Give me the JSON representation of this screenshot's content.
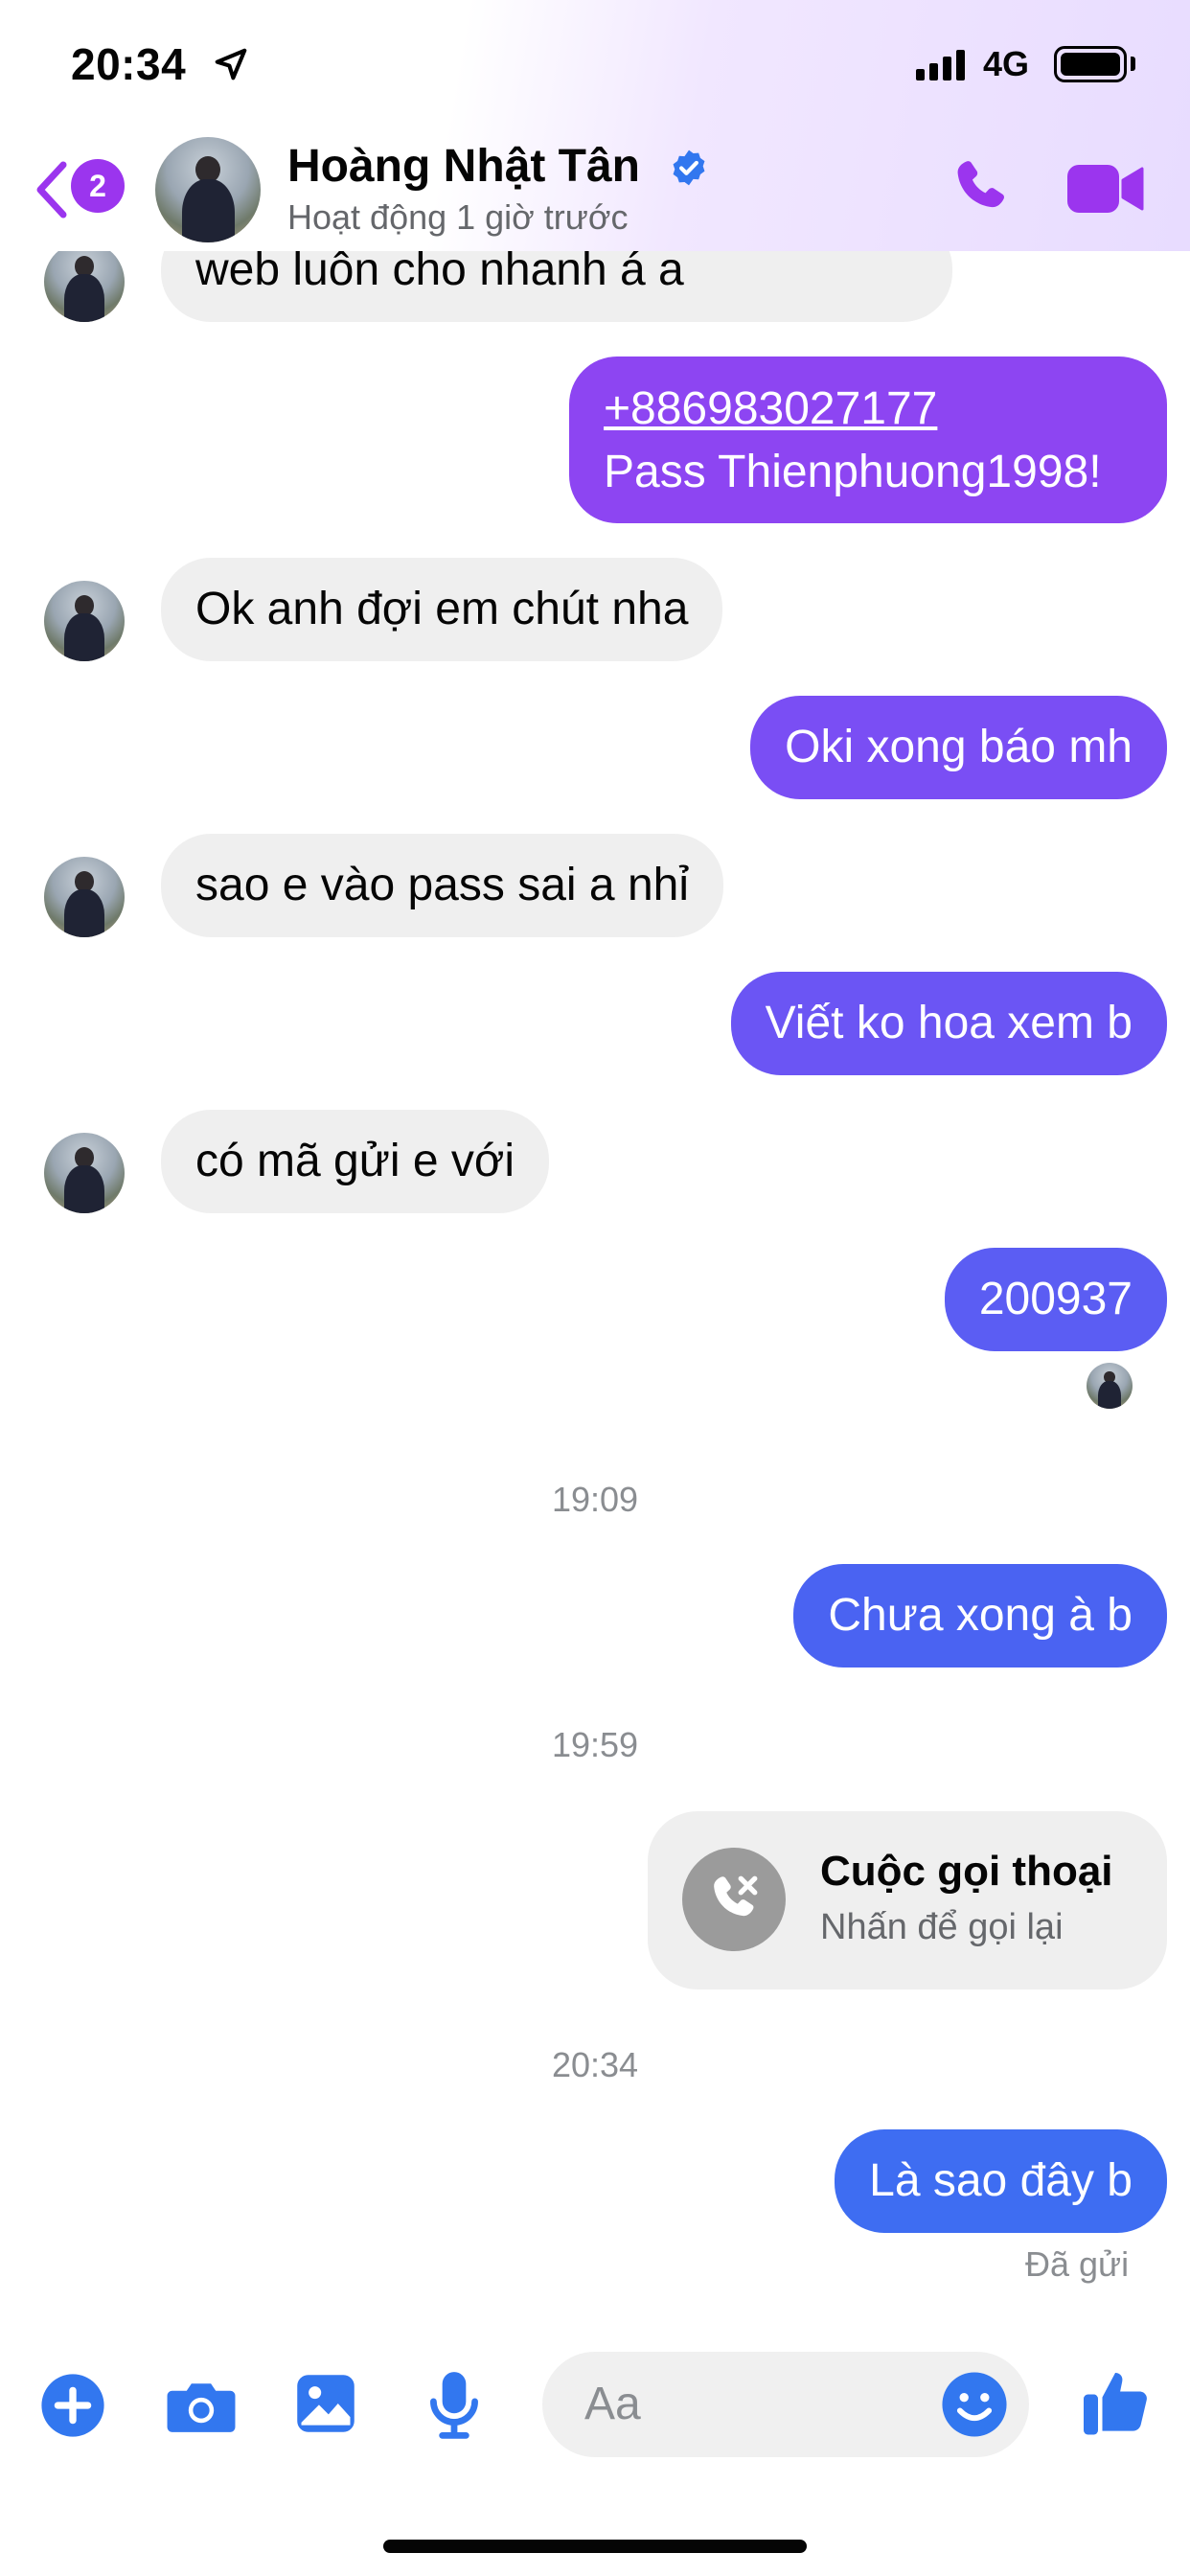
{
  "status_bar": {
    "time": "20:34",
    "network": "4G",
    "icons": [
      "location-arrow-icon",
      "signal-icon",
      "battery-icon"
    ]
  },
  "header": {
    "back_badge": "2",
    "name": "Hoàng Nhật Tân",
    "status": "Hoạt động 1 giờ trước",
    "icons": [
      "chevron-left-icon",
      "verified-badge-icon",
      "phone-icon",
      "video-camera-icon"
    ]
  },
  "colors": {
    "accent_purple": "#9b35ee",
    "incoming_bubble": "#efefef",
    "outgoing_top": "#8d45f2",
    "outgoing_bottom": "#3e6df2",
    "composer_blue": "#3277ef"
  },
  "messages": {
    "m0": "web luôn cho nhanh á a",
    "m1_line1": "+886983027177",
    "m1_line2": "Pass Thienphuong1998!",
    "m2": "Ok anh đợi em chút nha",
    "m3": "Oki xong báo mh",
    "m4": "sao e vào pass sai a nhỉ",
    "m5": "Viết ko hoa xem b",
    "m6": "có mã gửi e với",
    "m7": "200937",
    "t1": "19:09",
    "m8": "Chưa xong à b",
    "t2": "19:59",
    "call_title": "Cuộc gọi thoại",
    "call_subtitle": "Nhấn để gọi lại",
    "t3": "20:34",
    "m9": "Là sao đây b",
    "sent_status": "Đã gửi"
  },
  "composer": {
    "placeholder": "Aa",
    "icons": [
      "plus-icon",
      "camera-icon",
      "image-icon",
      "microphone-icon",
      "emoji-icon",
      "thumbs-up-icon"
    ]
  }
}
